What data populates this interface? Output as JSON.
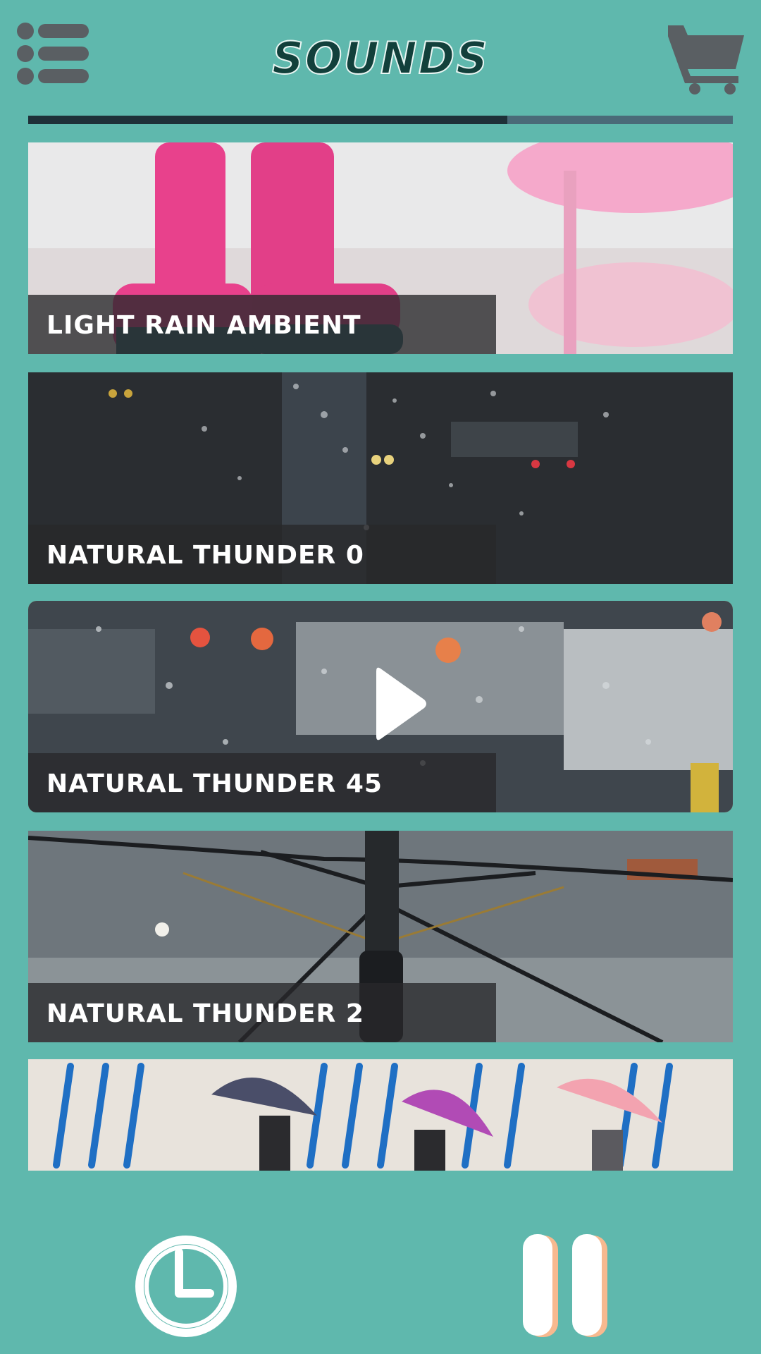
{
  "header": {
    "title": "SOUNDS",
    "menu_icon": "list-menu-icon",
    "cart_icon": "shopping-cart-icon"
  },
  "sounds": [
    {
      "label": "LIGHT RAIN AMBIENT",
      "image": "pink-rain-boots"
    },
    {
      "label": "NATURAL THUNDER 0",
      "image": "rain-drops-window-night"
    },
    {
      "label": "NATURAL THUNDER 45",
      "image": "rain-drops-window-street",
      "selected": true
    },
    {
      "label": "NATURAL THUNDER 2",
      "image": "umbrella-in-rain"
    }
  ],
  "player": {
    "timer_icon": "clock-icon",
    "pause_icon": "pause-icon",
    "play_icon": "play-icon"
  },
  "colors": {
    "background": "#5fb8ad",
    "title": "#12403b",
    "label_bar": "#28282a",
    "selected_border": "#f4e4a2",
    "pause_accent": "#f7b98f"
  }
}
